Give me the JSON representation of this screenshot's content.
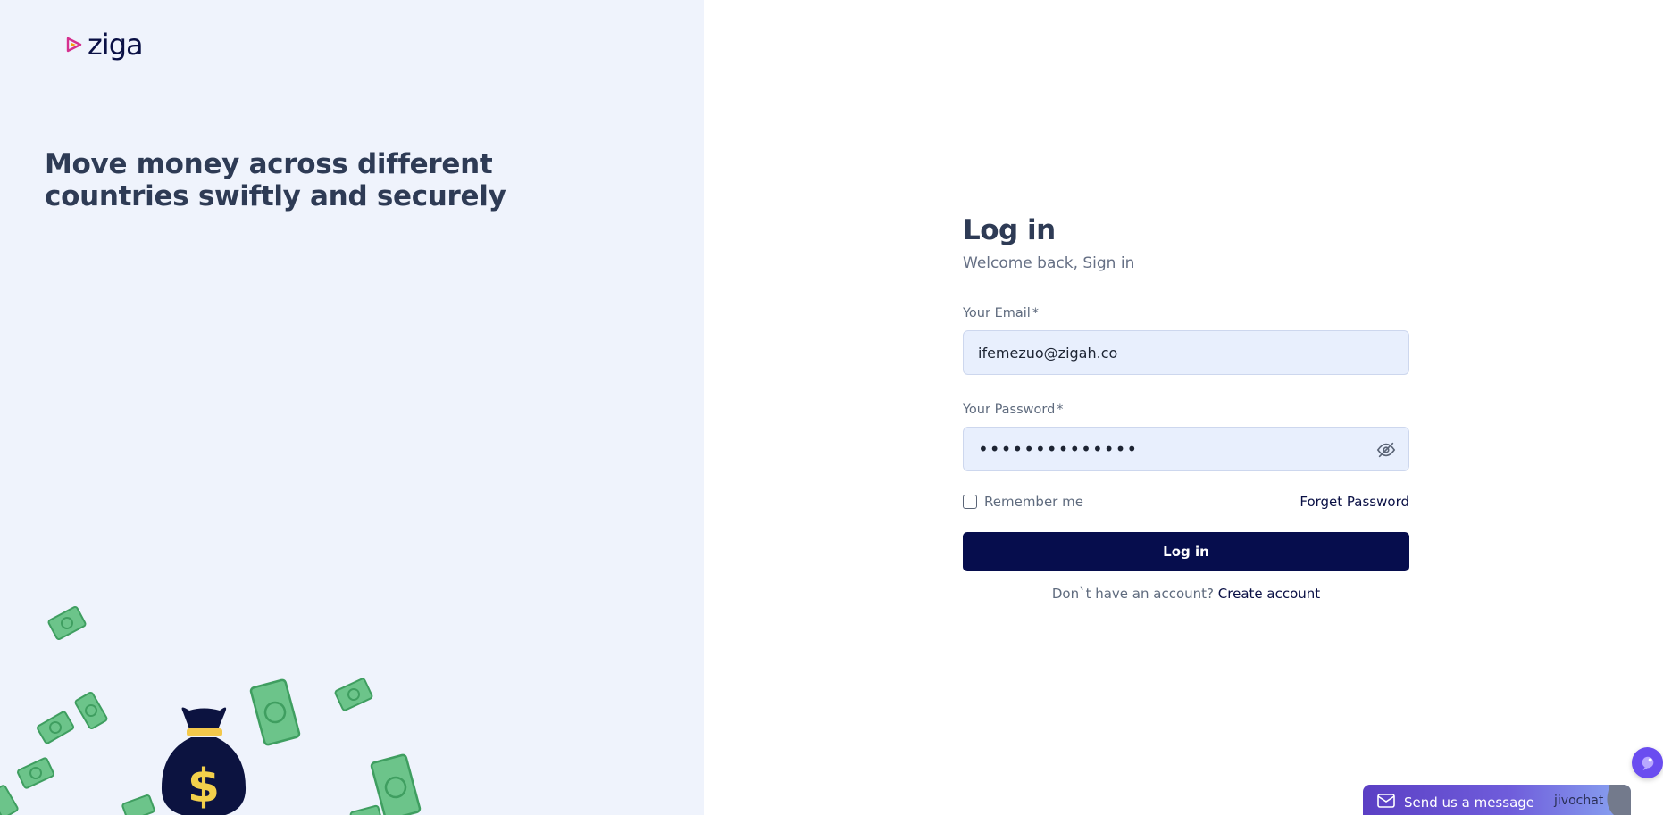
{
  "brand": {
    "name": "ziga",
    "colors": {
      "navy": "#060d4d",
      "magenta": "#d6308f",
      "orange": "#f59e0b",
      "cyan": "#22b8e3"
    }
  },
  "hero": {
    "tagline": "Move money across different countries swiftly and securely"
  },
  "login": {
    "title": "Log in",
    "subtitle": "Welcome back, Sign in",
    "email_label": "Your Email",
    "email_value": "ifemezuo@zigah.co",
    "password_label": "Your Password",
    "password_value": "••••••••••••••",
    "required_mark": "*",
    "remember_label": "Remember me",
    "remember_checked": false,
    "forgot_label": "Forget Password",
    "submit_label": "Log in",
    "no_account_text": "Don`t have an account?",
    "create_account_label": "Create account"
  },
  "icons": {
    "toggle_password": "eye-slash-icon",
    "chat": "mail-icon",
    "chat_launcher": "chat-bubble-icon"
  },
  "chat": {
    "label": "Send us a message",
    "brand": "jivochat"
  }
}
